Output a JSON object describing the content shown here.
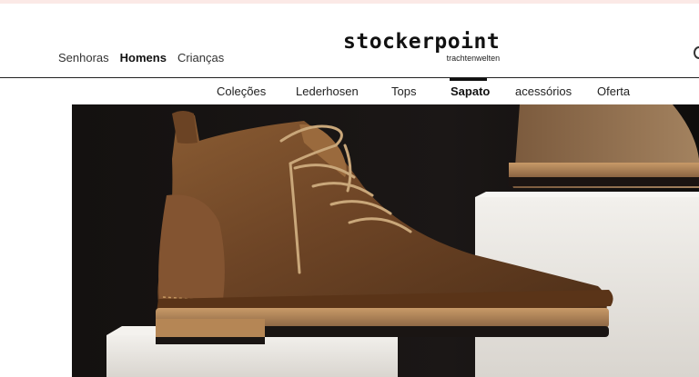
{
  "header": {
    "gender_nav": [
      {
        "label": "Senhoras",
        "active": false
      },
      {
        "label": "Homens",
        "active": true
      },
      {
        "label": "Crianças",
        "active": false
      }
    ],
    "logo": {
      "name": "stockerpoint",
      "tagline": "trachtenwelten"
    },
    "search_icon": "search-icon"
  },
  "category_nav": [
    {
      "label": "Coleções",
      "active": false
    },
    {
      "label": "Lederhosen",
      "active": false
    },
    {
      "label": "Tops",
      "active": false
    },
    {
      "label": "Sapato",
      "active": true
    },
    {
      "label": "acessórios",
      "active": false
    },
    {
      "label": "Oferta",
      "active": false
    }
  ],
  "hero": {
    "image": "brown-suede-lace-up-boot-on-white-pedestal",
    "colors": {
      "background": "#151211",
      "leather": "#7a4f2c",
      "pedestal": "#e9e6e1"
    }
  }
}
